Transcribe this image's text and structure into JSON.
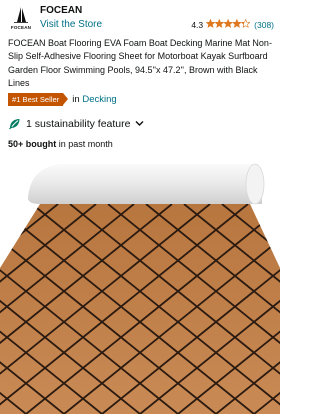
{
  "store": {
    "logo_text": "FOCEAN",
    "brand_name": "FOCEAN",
    "visit_label": "Visit the Store"
  },
  "rating": {
    "value": "4.3",
    "stars_filled": 4.3,
    "count": "(308)"
  },
  "product": {
    "title": "FOCEAN Boat Flooring EVA Foam Boat Decking Marine Mat Non-Slip Self-Adhesive Flooring Sheet for Motorboat Kayak Surfboard Garden Floor Swimming Pools, 94.5''x 47.2'', Brown with Black Lines"
  },
  "badge": {
    "label": "#1 Best Seller",
    "in_word": "in",
    "category": "Decking"
  },
  "sustainability": {
    "label": "1 sustainability feature"
  },
  "purchases": {
    "count": "50+ bought",
    "suffix": " in past month"
  },
  "colors": {
    "link": "#007185",
    "star": "#DE7921",
    "badge": "#C45500",
    "sustain": "#067D62",
    "mat_brown": "#C07A45",
    "mat_line": "#2B1A10"
  }
}
